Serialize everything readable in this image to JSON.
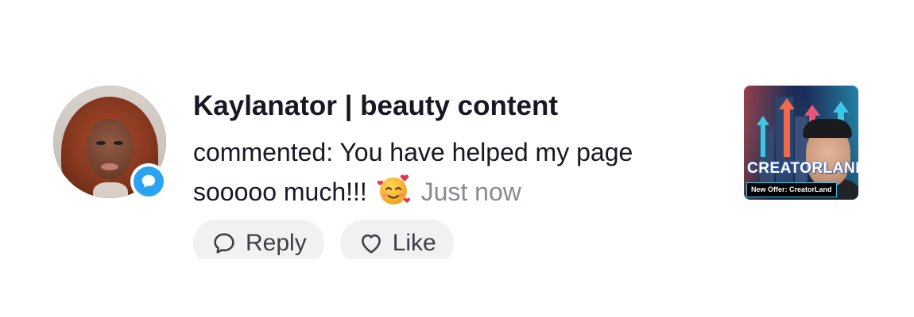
{
  "notification": {
    "username": "Kaylanator | beauty content",
    "comment_prefix": "commented: ",
    "comment_text": "You have helped my page sooooo much!!!",
    "emoji_name": "smiling-face-with-hearts",
    "time": "Just now"
  },
  "badge": {
    "icon": "comment-bubble-icon",
    "color": "#2aa3f5"
  },
  "actions": {
    "reply_label": "Reply",
    "like_label": "Like"
  },
  "thumbnail": {
    "headline": "CREATORLAND",
    "offer_text": "New Offer: CreatorLand"
  }
}
